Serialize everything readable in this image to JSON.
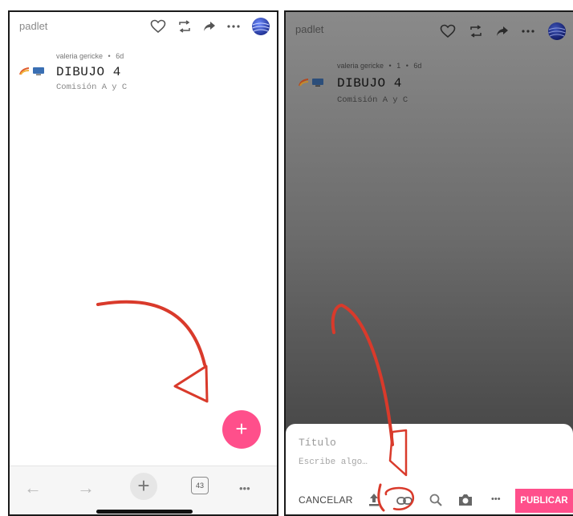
{
  "left_panel": {
    "brand": "padlet",
    "author": "valeria gericke",
    "time": "6d",
    "title": "DIBUJO 4",
    "subtitle": "Comisión A y C",
    "fab_symbol": "+",
    "nav": {
      "back_symbol": "←",
      "forward_symbol": "→",
      "add_symbol": "+",
      "tabs_count": "43",
      "more_symbol": "•••"
    }
  },
  "right_panel": {
    "brand": "padlet",
    "author": "valeria gericke",
    "count": "1",
    "time": "6d",
    "title": "DIBUJO 4",
    "subtitle": "Comisión A y C",
    "composer": {
      "title_placeholder": "Título",
      "body_placeholder": "Escribe algo…",
      "cancel_label": "CANCELAR",
      "more_symbol": "•••",
      "publish_label": "PUBLICAR"
    }
  },
  "colors": {
    "accent": "#ff4f8b",
    "annotation": "#d93a2b"
  },
  "icons": [
    "heart-icon",
    "remix-icon",
    "share-icon",
    "more-icon",
    "avatar",
    "upload-icon",
    "link-icon",
    "search-icon",
    "camera-icon"
  ]
}
